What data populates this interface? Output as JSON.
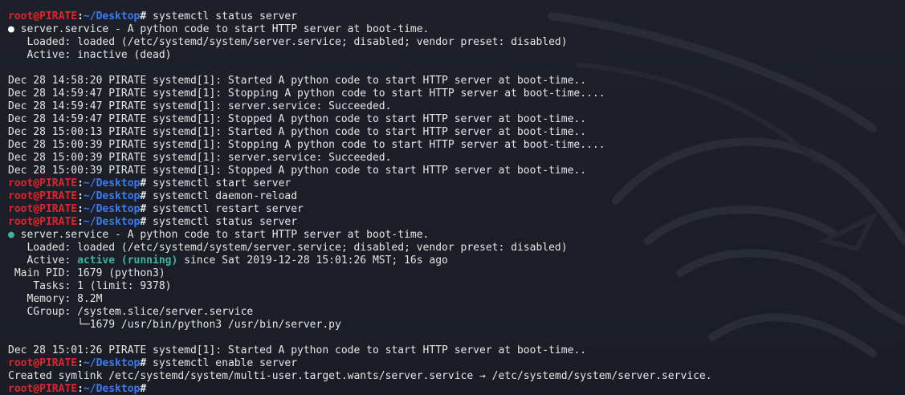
{
  "prompt": {
    "user_host": "root@PIRATE",
    "sep": ":",
    "path": "~/Desktop",
    "symbol": "#"
  },
  "status_dot": "●",
  "colors": {
    "background": "#1b1e26",
    "prompt_user": "#e0242f",
    "prompt_path": "#3a7cf0",
    "active": "#3bb59b"
  },
  "lines": [
    {
      "type": "prompt",
      "cmd": " systemctl status server"
    },
    {
      "type": "dot",
      "dot_color": "white",
      "text": " server.service - A python code to start HTTP server at boot-time."
    },
    {
      "type": "text",
      "text": "   Loaded: loaded (/etc/systemd/system/server.service; disabled; vendor preset: disabled)"
    },
    {
      "type": "text",
      "text": "   Active: inactive (dead)"
    },
    {
      "type": "text",
      "text": ""
    },
    {
      "type": "text",
      "text": "Dec 28 14:58:20 PIRATE systemd[1]: Started A python code to start HTTP server at boot-time.."
    },
    {
      "type": "text",
      "text": "Dec 28 14:59:47 PIRATE systemd[1]: Stopping A python code to start HTTP server at boot-time...."
    },
    {
      "type": "text",
      "text": "Dec 28 14:59:47 PIRATE systemd[1]: server.service: Succeeded."
    },
    {
      "type": "text",
      "text": "Dec 28 14:59:47 PIRATE systemd[1]: Stopped A python code to start HTTP server at boot-time.."
    },
    {
      "type": "text",
      "text": "Dec 28 15:00:13 PIRATE systemd[1]: Started A python code to start HTTP server at boot-time.."
    },
    {
      "type": "text",
      "text": "Dec 28 15:00:39 PIRATE systemd[1]: Stopping A python code to start HTTP server at boot-time...."
    },
    {
      "type": "text",
      "text": "Dec 28 15:00:39 PIRATE systemd[1]: server.service: Succeeded."
    },
    {
      "type": "text",
      "text": "Dec 28 15:00:39 PIRATE systemd[1]: Stopped A python code to start HTTP server at boot-time.."
    },
    {
      "type": "prompt",
      "cmd": " systemctl start server"
    },
    {
      "type": "prompt",
      "cmd": " systemctl daemon-reload"
    },
    {
      "type": "prompt",
      "cmd": " systemctl restart server"
    },
    {
      "type": "prompt",
      "cmd": " systemctl status server"
    },
    {
      "type": "dot",
      "dot_color": "green",
      "text": " server.service - A python code to start HTTP server at boot-time."
    },
    {
      "type": "text",
      "text": "   Loaded: loaded (/etc/systemd/system/server.service; disabled; vendor preset: disabled)"
    },
    {
      "type": "active",
      "pre": "   Active: ",
      "highlight": "active (running)",
      "post": " since Sat 2019-12-28 15:01:26 MST; 16s ago"
    },
    {
      "type": "text",
      "text": " Main PID: 1679 (python3)"
    },
    {
      "type": "text",
      "text": "    Tasks: 1 (limit: 9378)"
    },
    {
      "type": "text",
      "text": "   Memory: 8.2M"
    },
    {
      "type": "text",
      "text": "   CGroup: /system.slice/server.service"
    },
    {
      "type": "text",
      "text": "           └─1679 /usr/bin/python3 /usr/bin/server.py"
    },
    {
      "type": "text",
      "text": ""
    },
    {
      "type": "text",
      "text": "Dec 28 15:01:26 PIRATE systemd[1]: Started A python code to start HTTP server at boot-time.."
    },
    {
      "type": "prompt",
      "cmd": " systemctl enable server"
    },
    {
      "type": "text",
      "text": "Created symlink /etc/systemd/system/multi-user.target.wants/server.service → /etc/systemd/system/server.service."
    },
    {
      "type": "prompt",
      "cmd": ""
    }
  ]
}
